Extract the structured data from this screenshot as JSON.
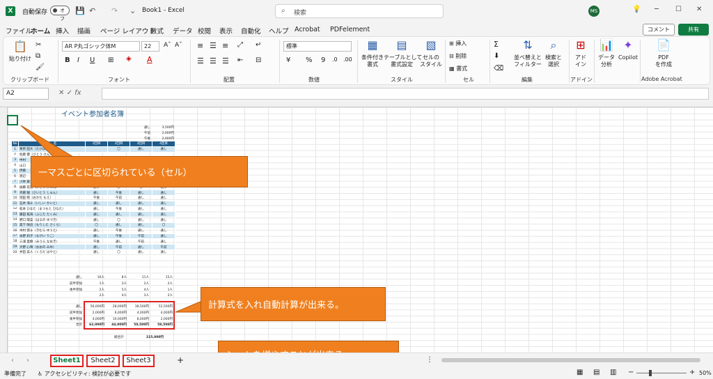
{
  "titlebar": {
    "autosave": "自動保存",
    "toggle": "オフ",
    "doc_title": "Book1 - Excel",
    "search_placeholder": "検索",
    "avatar": "MS"
  },
  "tabs": [
    "ファイル",
    "ホーム",
    "挿入",
    "描画",
    "ページ レイアウト",
    "数式",
    "データ",
    "校閲",
    "表示",
    "自動化",
    "ヘルプ",
    "Acrobat",
    "PDFelement"
  ],
  "active_tab": "ホーム",
  "comment_btn": "コメント",
  "share_btn": "共有",
  "ribbon": {
    "paste": "貼り付け",
    "clipboard": "クリップボード",
    "font_name": "AR P丸ゴシック体M",
    "font_size": "22",
    "font": "フォント",
    "alignment": "配置",
    "number_format": "標準",
    "number": "数値",
    "cond_format": "条件付き\n書式",
    "table_format": "テーブルとして\n書式設定",
    "cell_style": "セルの\nスタイル",
    "styles": "スタイル",
    "insert": "挿入",
    "delete": "削除",
    "format": "書式",
    "cells": "セル",
    "sort_filter": "並べ替えと\nフィルター",
    "find_select": "検索と\n選択",
    "editing": "編集",
    "addin": "アド\nイン",
    "addin_grp": "アドイン",
    "data_analysis": "データ\n分析",
    "copilot": "Copilot",
    "pdf_create": "PDF\nを作成",
    "adobe": "Adobe Acrobat"
  },
  "namebox": "A2",
  "sheet": {
    "title": "イベント参加者名簿",
    "price_labels": [
      [
        "通し",
        "3,500円"
      ],
      [
        "午前",
        "2,000円"
      ],
      [
        "午後",
        "2,000円"
      ]
    ],
    "headers": [
      "No",
      "氏　名",
      "1回目",
      "2回目",
      "3回目",
      "4回目"
    ],
    "rows": [
      [
        "1",
        "栗原 田大（たかはし だいき）",
        "",
        "〇",
        "通し",
        "通し"
      ],
      [
        "2",
        "佐藤 健（さとう けん）",
        "",
        "",
        "",
        ""
      ],
      [
        "3",
        "中村 ",
        "",
        "",
        "",
        ""
      ],
      [
        "4",
        "山口 ",
        "",
        "",
        "",
        ""
      ],
      [
        "5",
        "伊藤 ",
        "",
        "",
        "",
        ""
      ],
      [
        "6",
        "渡辺 ",
        "",
        "",
        "",
        ""
      ],
      [
        "7",
        "小林 葵（こばやし れん）",
        "通し",
        "午後",
        "通し",
        "通し"
      ],
      [
        "8",
        "加藤 花音（かとう かのん）",
        "通し",
        "〇",
        "〇",
        "通し"
      ],
      [
        "9",
        "斉藤 駿（さいとう しゅん）",
        "通し",
        "午後",
        "通し",
        "通し"
      ],
      [
        "10",
        "岡田 萌（おかだ もえ）",
        "午後",
        "午前",
        "通し",
        "通し"
      ],
      [
        "11",
        "石井 海斗（いしい かいと）",
        "通し",
        "通し",
        "通し",
        "通し"
      ],
      [
        "12",
        "松本 ひなた（まつもと ひなた）",
        "通し",
        "午後",
        "通し",
        "通し"
      ],
      [
        "13",
        "藤田 拓海（ふじた たくみ）",
        "通し",
        "通し",
        "通し",
        "通し"
      ],
      [
        "14",
        "野口 陽菜（はるの ゆづき）",
        "通し",
        "〇",
        "通し",
        "通し"
      ],
      [
        "15",
        "森下 咲良（もりした さくら）",
        "〇",
        "通し",
        "通し",
        "〇"
      ],
      [
        "16",
        "木村 悠斗（きむら ゆうと）",
        "通し",
        "午後",
        "通し",
        "通し"
      ],
      [
        "17",
        "永野 莉子（ながい りこ）",
        "通し",
        "午後",
        "午前",
        "通し"
      ],
      [
        "18",
        "三浦 直樹（みうら なおき）",
        "午後",
        "通し",
        "午前",
        "通し"
      ],
      [
        "19",
        "大野 心晴（おおの みゆ）",
        "通し",
        "午前",
        "通し",
        "午前"
      ],
      [
        "20",
        "井田 美人（くろだ はやと）",
        "通し",
        "〇",
        "通し",
        "通し"
      ]
    ],
    "counts": [
      [
        "通し",
        "16人",
        "8人",
        "11人",
        "15人"
      ],
      [
        "前半参加",
        "1人",
        "3人",
        "2人",
        "2人"
      ],
      [
        "後半参加",
        "2人",
        "5人",
        "4人",
        "1人"
      ],
      [
        "",
        "2人",
        "4人",
        "3人",
        "2人"
      ]
    ],
    "sums": [
      [
        "通し",
        "56,000円",
        "28,000円",
        "38,500円",
        "52,500円"
      ],
      [
        "前半参加",
        "2,000円",
        "6,000円",
        "4,000円",
        "4,000円"
      ],
      [
        "後半参加",
        "4,000円",
        "10,000円",
        "8,000円",
        "2,000円"
      ],
      [
        "合計",
        "62,000円",
        "44,000円",
        "50,500円",
        "58,500円"
      ]
    ],
    "grand_total_label": "総合計",
    "grand_total": "215,000円"
  },
  "callouts": {
    "cell": "一マスごとに区切られている（セル）",
    "calc": "計算式を入れ自動計算が出来る。",
    "sheet": "シートを増やすことが出来る。"
  },
  "sheet_tabs": [
    "Sheet1",
    "Sheet2",
    "Sheet3"
  ],
  "status": {
    "ready": "準備完了",
    "accessibility": "アクセシビリティ: 検討が必要です",
    "zoom": "50%"
  }
}
